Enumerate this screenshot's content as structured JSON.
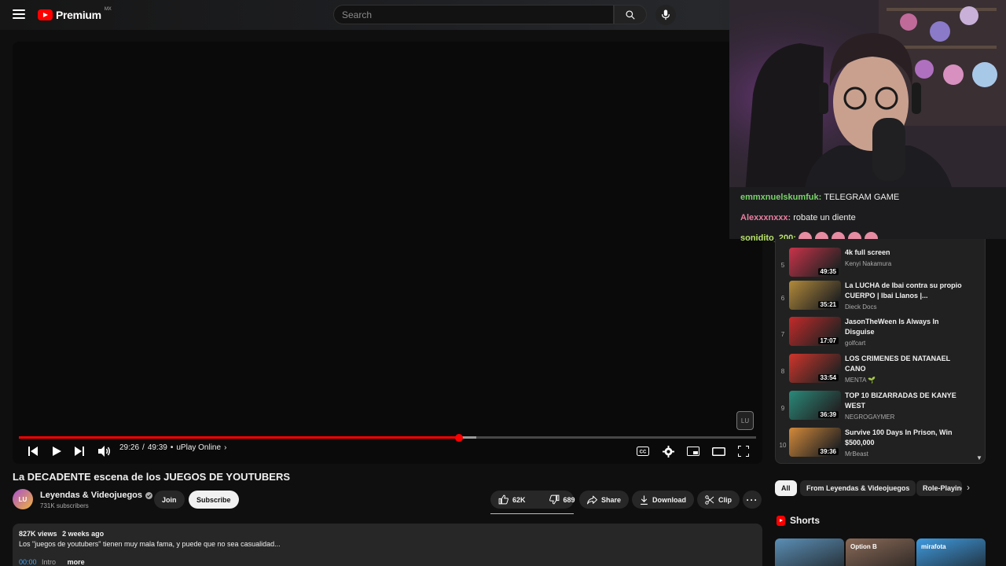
{
  "header": {
    "brand": "Premium",
    "country": "MX",
    "search_placeholder": "Search"
  },
  "player": {
    "time_current": "29:26",
    "time_total": "49:39",
    "time_sep": "/",
    "chapter": "uPlay Online",
    "played_fraction": 0.597,
    "buffered_fraction": 0.62,
    "watermark": "LU"
  },
  "video": {
    "title": "La DECADENTE escena de los JUEGOS DE YOUTUBERS",
    "channel": "Leyendas & Videojuegos",
    "channel_avatar_text": "LU",
    "subscribers": "731K subscribers",
    "join_label": "Join",
    "subscribe_label": "Subscribe",
    "likes": "62K",
    "dislikes": "689",
    "share_label": "Share",
    "download_label": "Download",
    "clip_label": "Clip"
  },
  "description": {
    "views": "827K views",
    "date": "2 weeks ago",
    "text": "Los \"juegos de youtubers\" tienen muy mala fama, y puede que no sea casualidad...",
    "timestamp": "00:00",
    "chapter": "Intro",
    "more_label": "more"
  },
  "chat": [
    {
      "user": "emmxnuelskumfuk:",
      "text": "TELEGRAM GAME"
    },
    {
      "user": "Alexxxnxxx:",
      "text": "robate un diente"
    },
    {
      "user": "sonidito_200:",
      "text": ""
    }
  ],
  "playlist": [
    {
      "index": "5",
      "title": "4k full screen",
      "channel": "Kenyi Nakamura",
      "duration": "49:35",
      "color": "#c9334a"
    },
    {
      "index": "6",
      "title": "La LUCHA de Ibai contra su propio CUERPO | Ibai Llanos |...",
      "channel": "Dieck Docs",
      "duration": "35:21",
      "color": "#b38a3a"
    },
    {
      "index": "7",
      "title": "JasonTheWeen Is Always In Disguise",
      "channel": "golfcart",
      "duration": "17:07",
      "color": "#c42a2a"
    },
    {
      "index": "8",
      "title": "LOS CRIMENES DE NATANAEL CANO",
      "channel": "MENTA 🌱",
      "duration": "33:54",
      "color": "#d0352b"
    },
    {
      "index": "9",
      "title": "TOP 10 BIZARRADAS DE KANYE WEST",
      "channel": "NEGROGAYMER",
      "duration": "36:39",
      "color": "#2a8a7a"
    },
    {
      "index": "10",
      "title": "Survive 100 Days In Prison, Win $500,000",
      "channel": "MrBeast",
      "duration": "39:36",
      "color": "#d48a3a"
    }
  ],
  "chips": {
    "all": "All",
    "from": "From Leyendas & Videojuegos",
    "role": "Role-Playing"
  },
  "shorts": {
    "label": "Shorts",
    "items": [
      {
        "color": "#5b8fb6",
        "text": ""
      },
      {
        "color": "#8a6a58",
        "text": "Option B"
      },
      {
        "color": "#3f9be0",
        "text": "mirafota"
      }
    ]
  },
  "colors": {
    "accent": "#ff0000",
    "background": "#0f0f0f",
    "surface": "#272727"
  }
}
